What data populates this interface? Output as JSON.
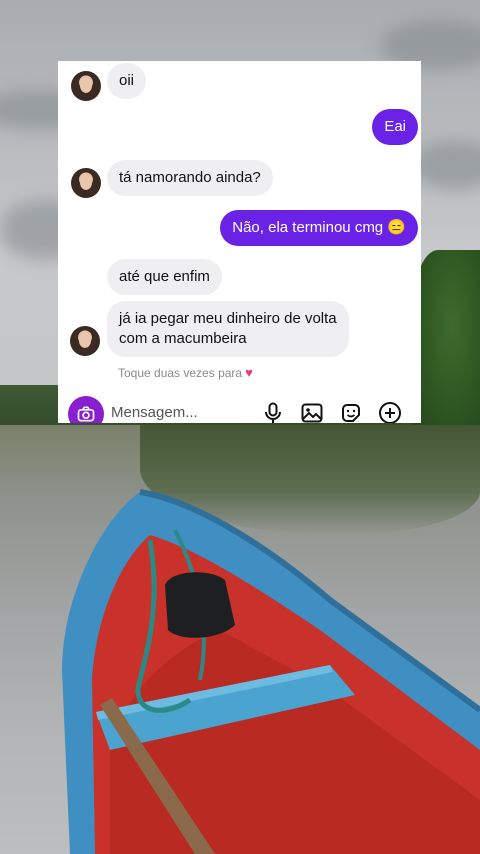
{
  "chat": {
    "messages": [
      {
        "from": "them",
        "text": "oii"
      },
      {
        "from": "me",
        "text": "Eai"
      },
      {
        "from": "them",
        "text": "tá namorando ainda?"
      },
      {
        "from": "me",
        "text": "Não, ela terminou cmg 😑"
      },
      {
        "from": "them",
        "text": "até que enfim"
      },
      {
        "from": "them",
        "text": "já ia pegar meu dinheiro de volta\ncom a macumbeira"
      }
    ],
    "hint": "Toque duas vezes para",
    "hint_icon": "heart-icon"
  },
  "composer": {
    "placeholder": "Mensagem...",
    "icons": [
      "camera-icon",
      "microphone-icon",
      "gallery-icon",
      "sticker-icon",
      "plus-icon"
    ]
  },
  "colors": {
    "outgoing": "#6a23e6",
    "incoming": "#efeff1",
    "camera": "#8a1fd0",
    "heart": "#e4406f"
  }
}
